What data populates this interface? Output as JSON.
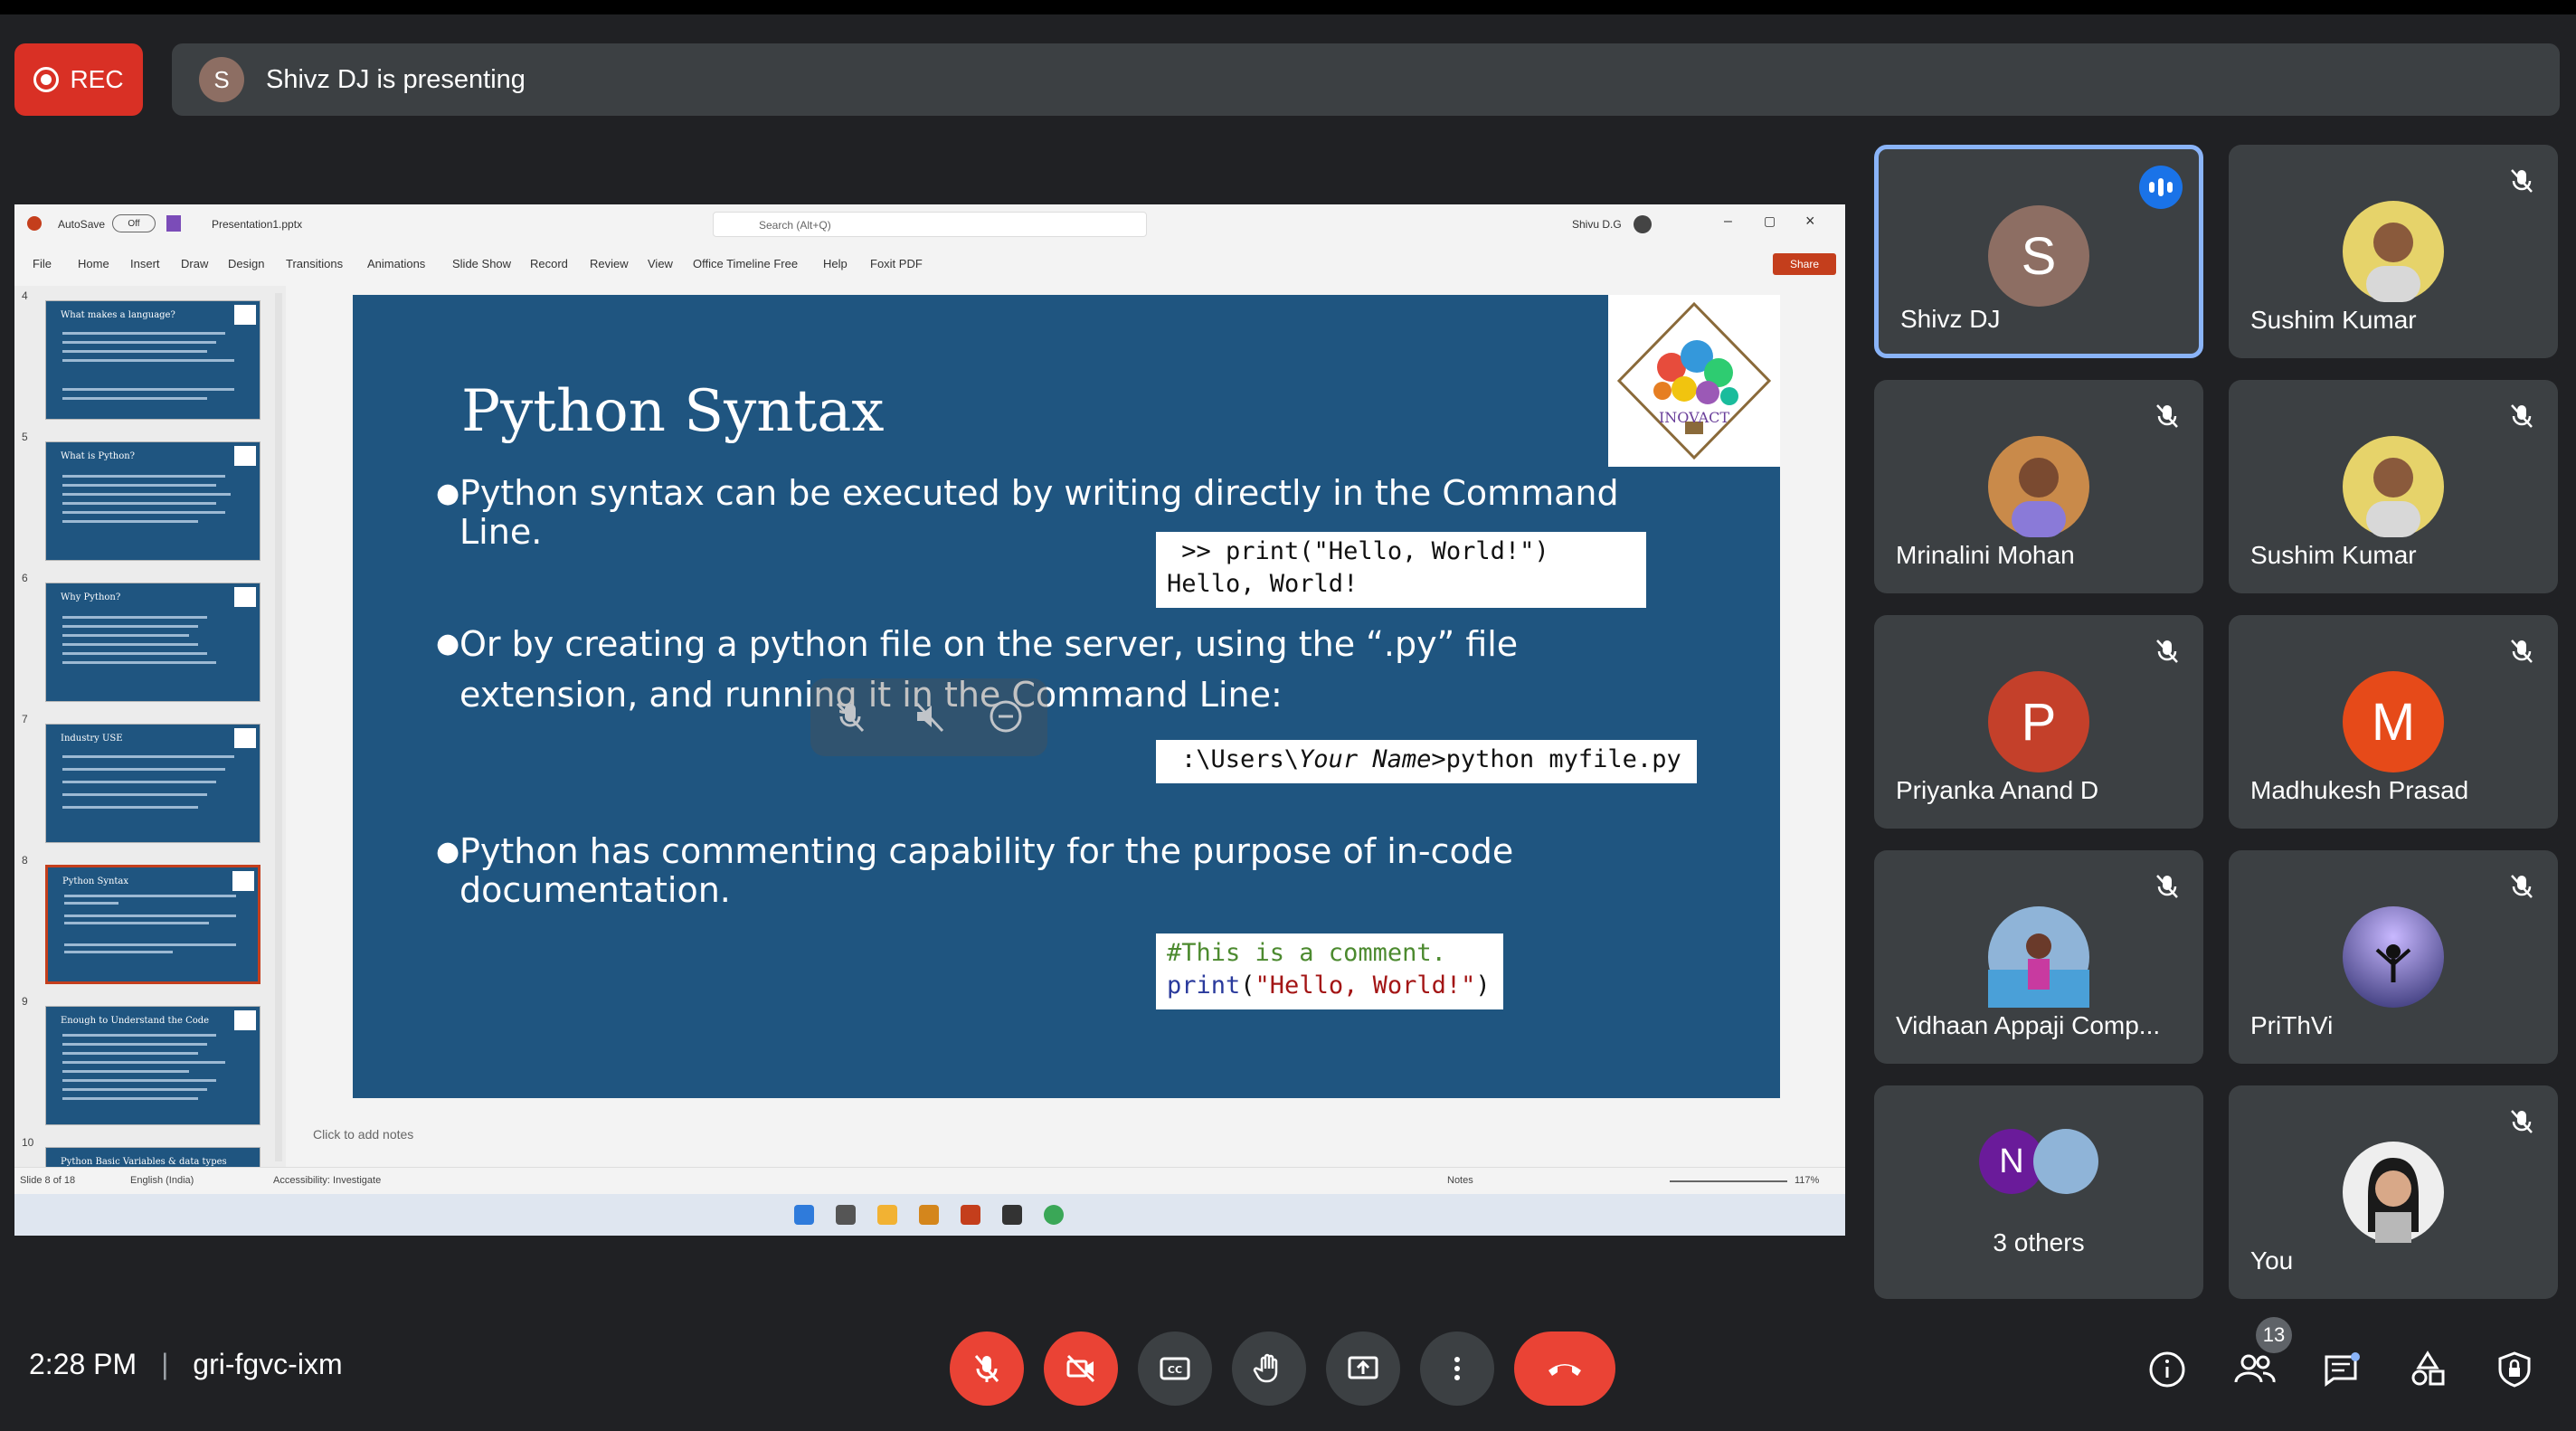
{
  "meet": {
    "rec_label": "REC",
    "presenter_initial": "S",
    "presenting_text": "Shivz DJ is presenting",
    "time": "2:28 PM",
    "meeting_code": "gri-fgvc-ixm",
    "people_count": "13"
  },
  "ppt": {
    "autosave": "AutoSave",
    "autosave_state": "Off",
    "filename": "Presentation1.pptx",
    "search_placeholder": "Search (Alt+Q)",
    "user": "Shivu D.G",
    "share": "Share",
    "menu": [
      "File",
      "Home",
      "Insert",
      "Draw",
      "Design",
      "Transitions",
      "Animations",
      "Slide Show",
      "Record",
      "Review",
      "View",
      "Office Timeline Free",
      "Help",
      "Foxit PDF"
    ],
    "thumbnails": [
      {
        "num": "4",
        "title": "What makes a language?"
      },
      {
        "num": "5",
        "title": "What is Python?"
      },
      {
        "num": "6",
        "title": "Why Python?"
      },
      {
        "num": "7",
        "title": "Industry USE"
      },
      {
        "num": "8",
        "title": "Python Syntax"
      },
      {
        "num": "9",
        "title": "Enough to Understand the Code"
      },
      {
        "num": "10",
        "title": "Python Basic Variables & data types"
      }
    ],
    "notes_placeholder": "Click to add notes",
    "status_slide": "Slide 8 of 18",
    "status_lang": "English (India)",
    "status_access": "Accessibility: Investigate",
    "status_notes": "Notes",
    "status_zoom": "117%"
  },
  "slide": {
    "title": "Python Syntax",
    "bullet1": "Python syntax can be executed by writing directly in the Command Line.",
    "code1_line1": " >> print(\"Hello, World!\")",
    "code1_line2": "Hello, World!",
    "bullet2": "Or by creating a python file on the server, using the “.py” file extension, and running it in the Command Line:",
    "code2_pre": ":\\Users\\",
    "code2_ital": "Your Name",
    "code2_post": ">python myfile.py",
    "bullet3": "Python has commenting capability for the purpose of in-code documentation.",
    "code3_comment": "#This is a comment.",
    "code3_kw": "print",
    "code3_rest1": "(",
    "code3_str": "\"Hello, World!\"",
    "code3_rest2": ")",
    "logo_text": "INOVACT"
  },
  "participants": [
    {
      "name": "Shivz DJ",
      "initial": "S",
      "color": "#8d6e63"
    },
    {
      "name": "Sushim Kumar",
      "initial": "",
      "color": "#e6d36a"
    },
    {
      "name": "Mrinalini Mohan",
      "initial": "",
      "color": "#c98a4a"
    },
    {
      "name": "Sushim Kumar",
      "initial": "",
      "color": "#e6d36a"
    },
    {
      "name": "Priyanka Anand D",
      "initial": "P",
      "color": "#c4402a"
    },
    {
      "name": "Madhukesh Prasad",
      "initial": "M",
      "color": "#e64a19"
    },
    {
      "name": "Vidhaan Appaji Comp...",
      "initial": "",
      "color": "#8fb4d8"
    },
    {
      "name": "PriThVi",
      "initial": "",
      "color": "#4a4a8a"
    },
    {
      "name": "3 others",
      "initial": "N",
      "color": "#6a1b9a"
    },
    {
      "name": "You",
      "initial": "",
      "color": "#eeeeee"
    }
  ]
}
